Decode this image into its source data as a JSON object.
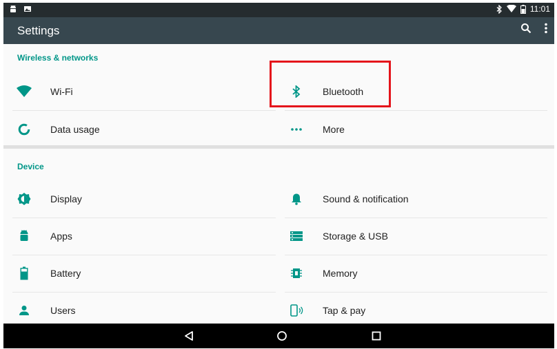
{
  "status_bar": {
    "time": "11:01",
    "left_icons": [
      "android-icon",
      "photo-icon"
    ],
    "right_icons": [
      "bluetooth-icon",
      "wifi-icon",
      "battery-icon"
    ]
  },
  "app_bar": {
    "title": "Settings",
    "actions": [
      "search-icon",
      "overflow-menu-icon"
    ]
  },
  "sections": [
    {
      "title": "Wireless & networks",
      "items": [
        {
          "label": "Wi-Fi",
          "icon": "wifi-icon"
        },
        {
          "label": "Bluetooth",
          "icon": "bluetooth-icon"
        },
        {
          "label": "Data usage",
          "icon": "data-usage-icon"
        },
        {
          "label": "More",
          "icon": "more-dots-icon"
        }
      ]
    },
    {
      "title": "Device",
      "items": [
        {
          "label": "Display",
          "icon": "display-brightness-icon"
        },
        {
          "label": "Sound & notification",
          "icon": "bell-icon"
        },
        {
          "label": "Apps",
          "icon": "android-icon"
        },
        {
          "label": "Storage & USB",
          "icon": "storage-icon"
        },
        {
          "label": "Battery",
          "icon": "battery-icon"
        },
        {
          "label": "Memory",
          "icon": "memory-chip-icon"
        },
        {
          "label": "Users",
          "icon": "user-icon"
        },
        {
          "label": "Tap & pay",
          "icon": "tap-pay-icon"
        }
      ]
    }
  ],
  "nav_bar": {
    "buttons": [
      "back-icon",
      "home-icon",
      "recents-icon"
    ]
  },
  "colors": {
    "accent": "#009688",
    "status_bar": "#252c2f",
    "app_bar": "#37474f",
    "highlight": "#e4141b"
  }
}
